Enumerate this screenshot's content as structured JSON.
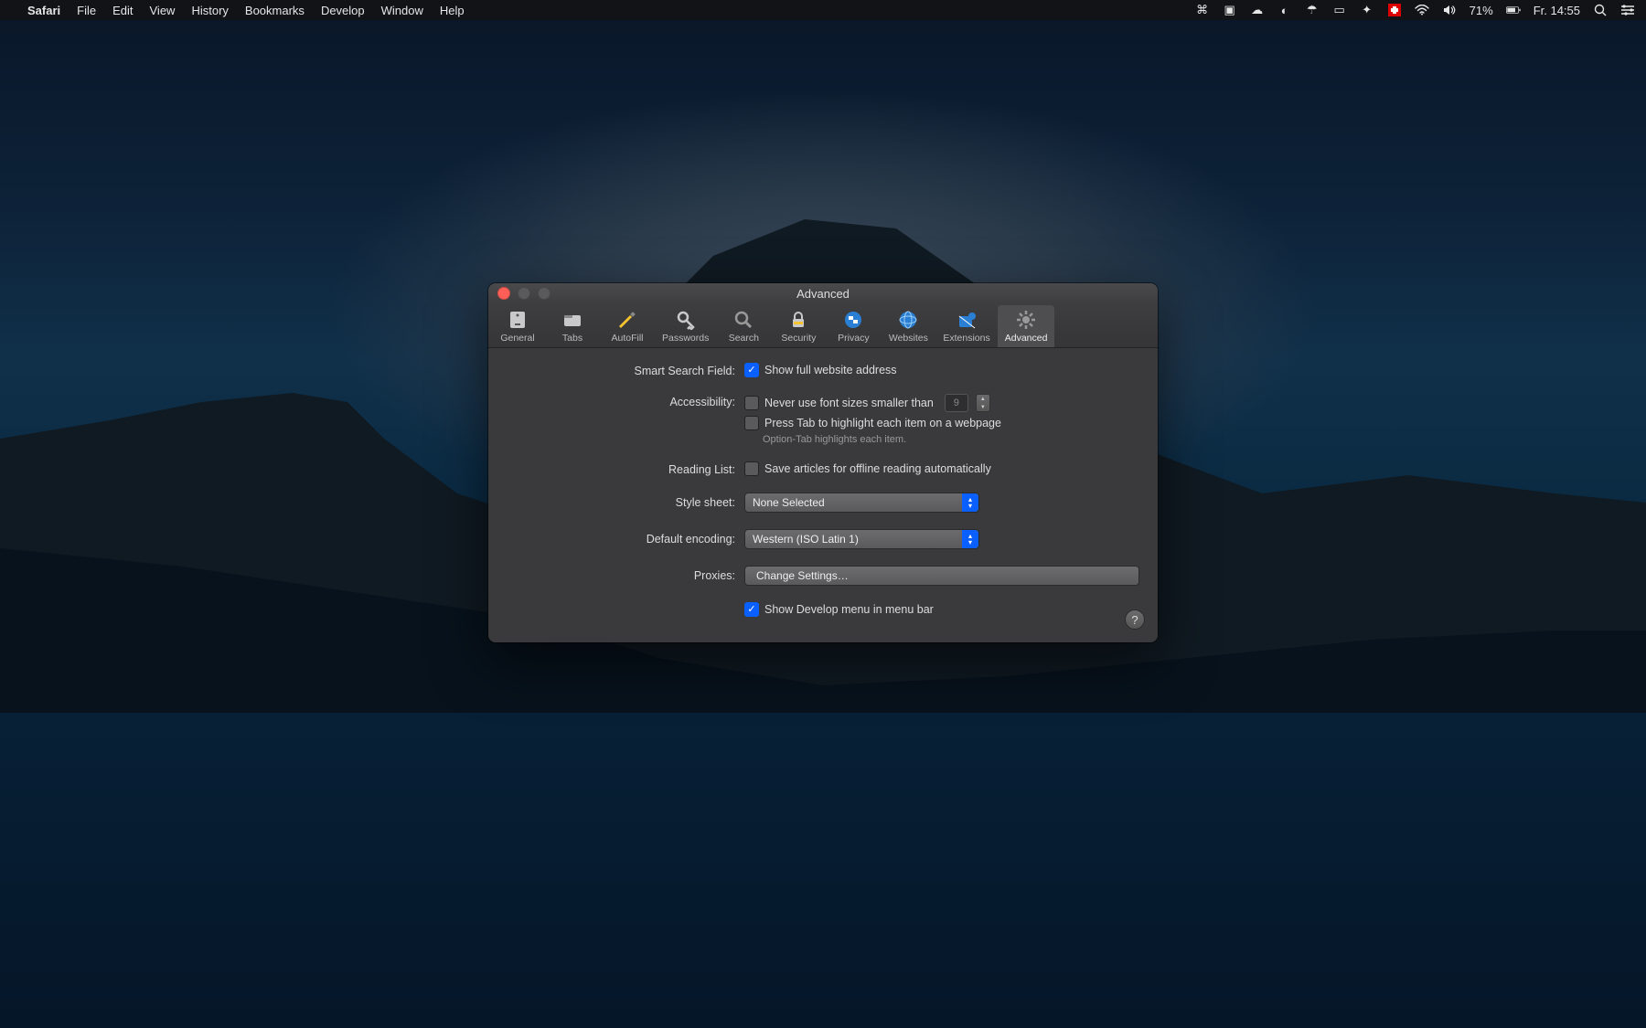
{
  "menubar": {
    "app": "Safari",
    "items": [
      "File",
      "Edit",
      "View",
      "History",
      "Bookmarks",
      "Develop",
      "Window",
      "Help"
    ],
    "battery": "71%",
    "clock": "Fr. 14:55"
  },
  "window": {
    "title": "Advanced",
    "tabs": [
      {
        "label": "General"
      },
      {
        "label": "Tabs"
      },
      {
        "label": "AutoFill"
      },
      {
        "label": "Passwords"
      },
      {
        "label": "Search"
      },
      {
        "label": "Security"
      },
      {
        "label": "Privacy"
      },
      {
        "label": "Websites"
      },
      {
        "label": "Extensions"
      },
      {
        "label": "Advanced"
      }
    ]
  },
  "advanced": {
    "smart_search_label": "Smart Search Field:",
    "show_full_address": "Show full website address",
    "accessibility_label": "Accessibility:",
    "never_font_sizes": "Never use font sizes smaller than",
    "font_size_value": "9",
    "press_tab": "Press Tab to highlight each item on a webpage",
    "option_tab_hint": "Option-Tab highlights each item.",
    "reading_list_label": "Reading List:",
    "save_articles": "Save articles for offline reading automatically",
    "stylesheet_label": "Style sheet:",
    "stylesheet_value": "None Selected",
    "encoding_label": "Default encoding:",
    "encoding_value": "Western (ISO Latin 1)",
    "proxies_label": "Proxies:",
    "change_settings": "Change Settings…",
    "show_develop": "Show Develop menu in menu bar",
    "help": "?"
  }
}
